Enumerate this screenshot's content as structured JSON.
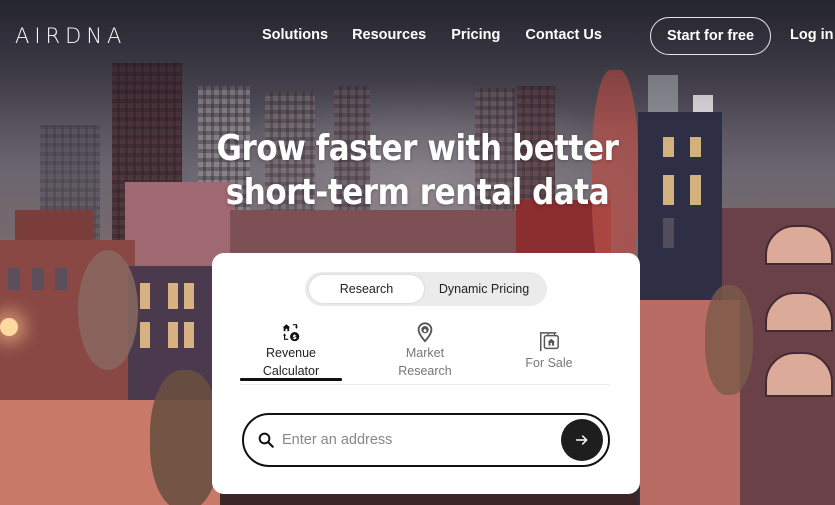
{
  "nav": {
    "logo": "AIRDNA",
    "links": [
      "Solutions",
      "Resources",
      "Pricing",
      "Contact Us"
    ],
    "start_button": "Start for free",
    "login": "Log in"
  },
  "hero": {
    "title_line1": "Grow faster with better",
    "title_line2": "short-term rental data"
  },
  "card": {
    "toggle": {
      "options": [
        "Research",
        "Dynamic Pricing"
      ],
      "selected": "Research"
    },
    "tabs": [
      {
        "label_line1": "Revenue",
        "label_line2": "Calculator",
        "icon": "house-dollar-exchange-icon",
        "active": true
      },
      {
        "label_line1": "Market",
        "label_line2": "Research",
        "icon": "map-pin-house-icon",
        "active": false
      },
      {
        "label_line1": "For Sale",
        "label_line2": "",
        "icon": "hanging-sign-house-icon",
        "active": false
      }
    ],
    "search": {
      "placeholder": "Enter an address",
      "value": "",
      "submit_icon": "arrow-right-icon"
    }
  },
  "colors": {
    "primary_dark": "#1e1e1e",
    "toggle_bg": "#ebebeb",
    "text_muted": "#777777"
  }
}
